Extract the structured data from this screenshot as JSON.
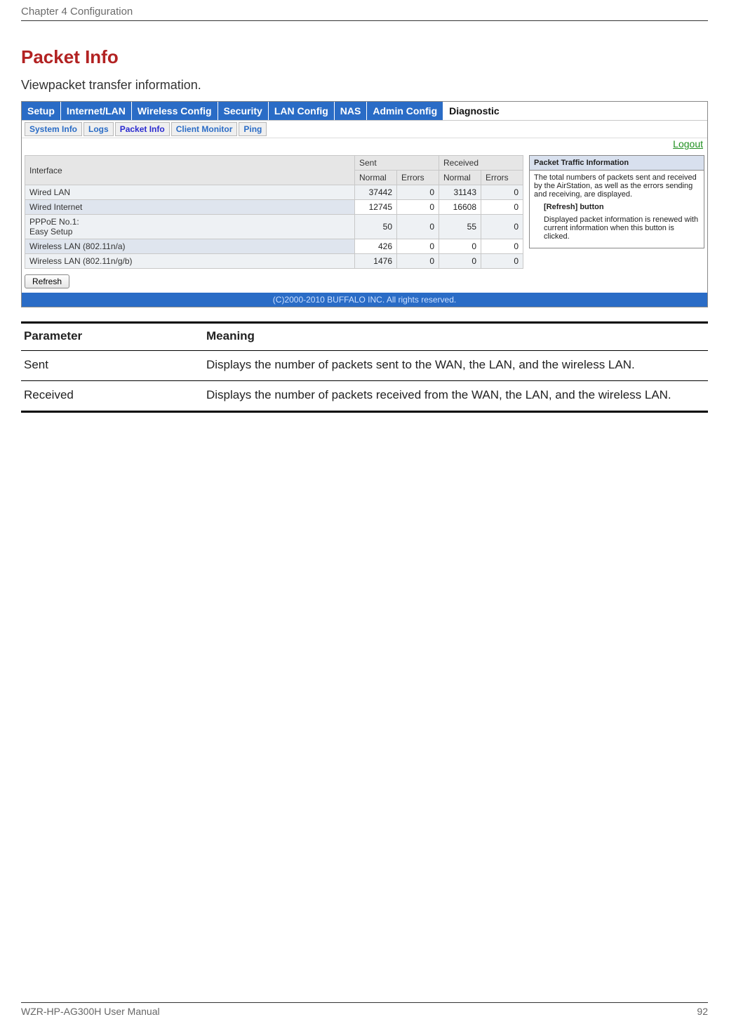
{
  "page_header": "Chapter 4  Configuration",
  "section_title": "Packet Info",
  "section_sub": "Viewpacket transfer information.",
  "tabs": {
    "items": [
      "Setup",
      "Internet/LAN",
      "Wireless Config",
      "Security",
      "LAN Config",
      "NAS",
      "Admin Config",
      "Diagnostic"
    ],
    "active_index": 7
  },
  "subtabs": {
    "items": [
      "System Info",
      "Logs",
      "Packet Info",
      "Client Monitor",
      "Ping"
    ],
    "active_index": 2
  },
  "logout": "Logout",
  "packet_table": {
    "header_interface": "Interface",
    "header_sent": "Sent",
    "header_received": "Received",
    "sub_normal": "Normal",
    "sub_errors": "Errors",
    "rows": [
      {
        "iface": "Wired LAN",
        "sent_n": "37442",
        "sent_e": "0",
        "recv_n": "31143",
        "recv_e": "0"
      },
      {
        "iface": "Wired Internet",
        "sent_n": "12745",
        "sent_e": "0",
        "recv_n": "16608",
        "recv_e": "0"
      },
      {
        "iface": "PPPoE No.1:\nEasy Setup",
        "sent_n": "50",
        "sent_e": "0",
        "recv_n": "55",
        "recv_e": "0"
      },
      {
        "iface": "Wireless LAN (802.11n/a)",
        "sent_n": "426",
        "sent_e": "0",
        "recv_n": "0",
        "recv_e": "0"
      },
      {
        "iface": "Wireless LAN (802.11n/g/b)",
        "sent_n": "1476",
        "sent_e": "0",
        "recv_n": "0",
        "recv_e": "0"
      }
    ],
    "refresh_label": "Refresh"
  },
  "sidebar": {
    "title": "Packet Traffic Information",
    "intro": "The total numbers of packets sent and received by the AirStation, as well as the errors sending and receiving, are displayed.",
    "btn_head": "[Refresh] button",
    "btn_body": "Displayed packet information is renewed with current information when this button is clicked."
  },
  "copyright": "(C)2000-2010 BUFFALO INC. All rights reserved.",
  "param_table": {
    "col_param": "Parameter",
    "col_meaning": "Meaning",
    "rows": [
      {
        "param": "Sent",
        "meaning": "Displays the number of packets sent to the WAN, the LAN, and the wireless LAN."
      },
      {
        "param": "Received",
        "meaning": "Displays the number of packets received from the WAN, the LAN, and the wireless LAN."
      }
    ]
  },
  "footer": {
    "left": "WZR-HP-AG300H User Manual",
    "right": "92"
  }
}
